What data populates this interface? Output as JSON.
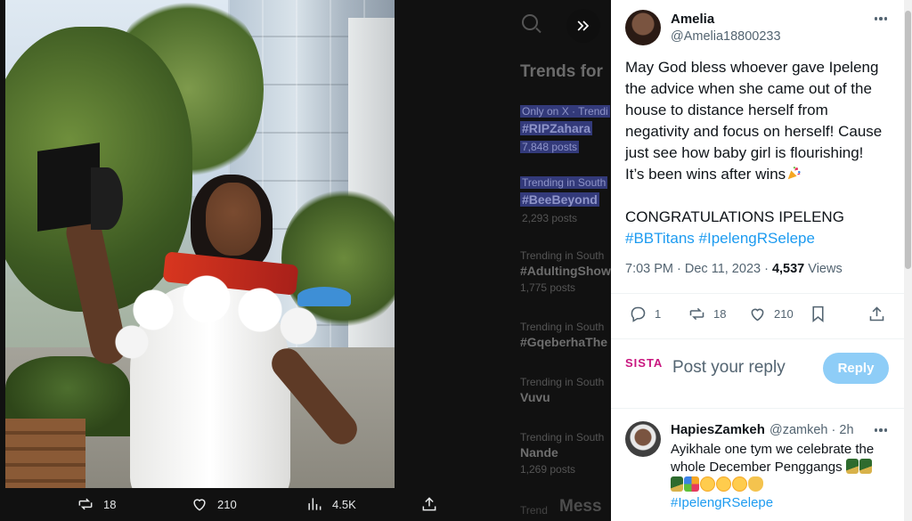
{
  "background_trends": {
    "title": "Trends for",
    "items": [
      {
        "context": "Only on X · Trendi",
        "tag": "#RIPZahara",
        "count": "7,848 posts",
        "highlight": true
      },
      {
        "context": "Trending in South",
        "tag": "#BeeBeyond",
        "count": "2,293 posts",
        "highlight": true
      },
      {
        "context": "Trending in South",
        "tag": "#AdultingShow",
        "count": "1,775 posts",
        "highlight": false
      },
      {
        "context": "Trending in South",
        "tag": "#GqeberhaThe",
        "count": "",
        "highlight": false
      },
      {
        "context": "Trending in South",
        "tag": "Vuvu",
        "count": "",
        "highlight": false
      },
      {
        "context": "Trending in South",
        "tag": "Nande",
        "count": "1,269 posts",
        "highlight": false
      }
    ],
    "messages_label": "Mess",
    "trend_label": "Trend"
  },
  "media_actions": {
    "retweets": "18",
    "likes": "210",
    "views": "4.5K"
  },
  "tweet": {
    "author_name": "Amelia",
    "author_handle": "@Amelia18800233",
    "text_lines": [
      "May God bless whoever gave Ipeleng",
      "the advice when she came out of the",
      "house to distance herself from",
      "negativity and focus on herself! Cause",
      "just see how baby girl is flourishing!",
      "It’s been wins after wins"
    ],
    "congrats": "CONGRATULATIONS IPELENG",
    "hashtags": "#BBTitans #IpelengRSelepe",
    "time": "7:03 PM · Dec 11, 2023 · ",
    "views_count": "4,537",
    "views_label": " Views",
    "stats": {
      "replies": "1",
      "retweets": "18",
      "likes": "210"
    }
  },
  "reply_box": {
    "avatar_text": "SISTA",
    "placeholder": "Post your reply",
    "button_label": "Reply"
  },
  "reply": {
    "user": "HapiesZamkeh",
    "handle": "@zamkeh · 2h",
    "text": "Ayikhale one tym we celebrate the whole December Penggangs",
    "tag": "#IpelengRSelepe"
  },
  "colors": {
    "accent": "#1d9bf0",
    "reply_button": "#8ecdf7",
    "secondary_text": "#536471"
  }
}
